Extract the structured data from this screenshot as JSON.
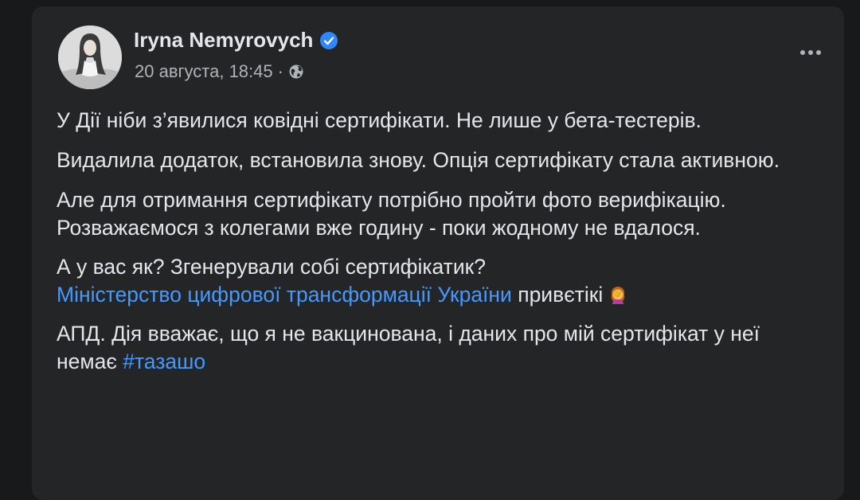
{
  "post": {
    "author": "Iryna Nemyrovych",
    "timestamp": "20 августа, 18:45",
    "separator": "·",
    "privacy_icon": "globe-icon",
    "verified_icon": "verified-badge-icon",
    "more_icon": "more-options-icon"
  },
  "content": {
    "p1": "У Дії ніби з’явилися ковідні сертифікати. Не лише у бета-тестерів.",
    "p2": "Видалила додаток, встановила знову. Опція сертифікату стала активною.",
    "p3": "Але для отримання сертифікату потрібно пройти фото верифікацію. Розважаємося з колегами вже годину - поки жодному не вдалося.",
    "p4_line1": "А у вас як? Згенерували собі сертифікатик?",
    "p4_mention": "Міністерство цифрової трансформації України",
    "p4_after_mention": " привєтікі",
    "p4_emoji": "woman-facepalming-emoji",
    "p5_text": "АПД. Дія вважає, що я не вакцинована, і даних про мій сертифікат у неї немає ",
    "p5_hashtag": "#тазашо"
  },
  "colors": {
    "page_bg": "#18191a",
    "card_bg": "#242526",
    "primary_text": "#e4e6eb",
    "secondary_text": "#b0b3b8",
    "link": "#4599ff",
    "verified": "#2d88ff"
  }
}
